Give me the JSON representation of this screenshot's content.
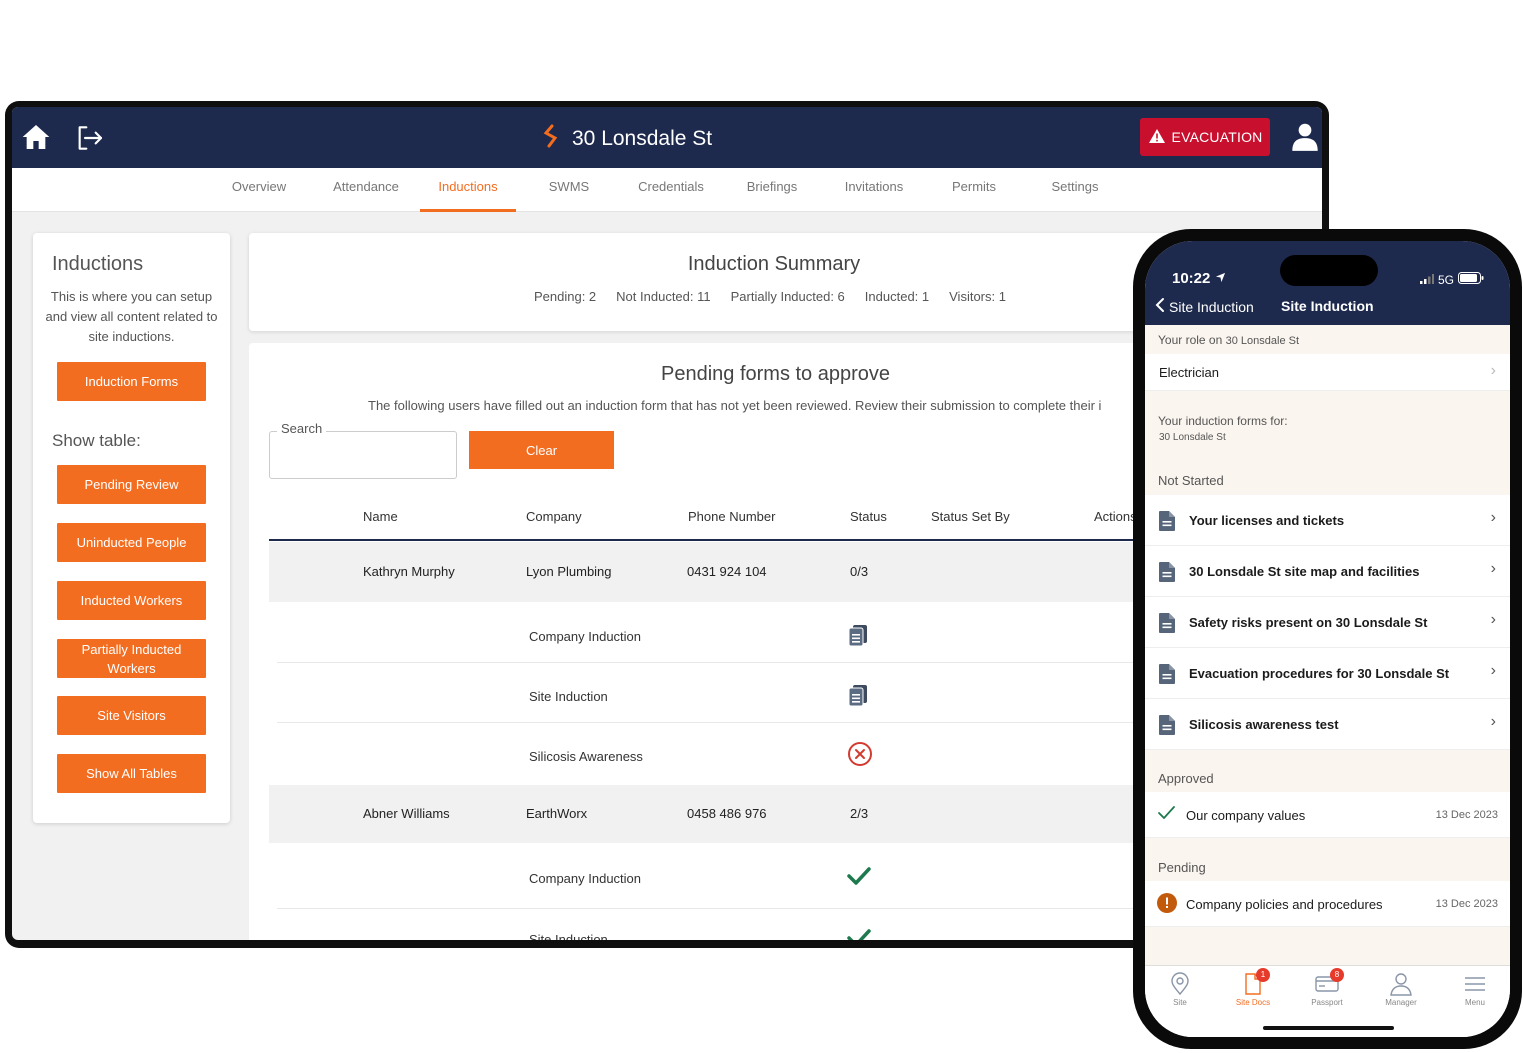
{
  "tablet": {
    "site_title": "30 Lonsdale St",
    "evacuation_label": "EVACUATION",
    "tabs": [
      {
        "label": "Overview",
        "active": false
      },
      {
        "label": "Attendance",
        "active": false
      },
      {
        "label": "Inductions",
        "active": true
      },
      {
        "label": "SWMS",
        "active": false
      },
      {
        "label": "Credentials",
        "active": false
      },
      {
        "label": "Briefings",
        "active": false
      },
      {
        "label": "Invitations",
        "active": false
      },
      {
        "label": "Permits",
        "active": false
      },
      {
        "label": "Settings",
        "active": false
      }
    ],
    "sidebar": {
      "title": "Inductions",
      "description": "This is where you can setup and view all content related to site inductions.",
      "forms_button": "Induction Forms",
      "show_table_label": "Show table:",
      "buttons": [
        "Pending Review",
        "Uninducted People",
        "Inducted Workers",
        "Partially Inducted Workers",
        "Site Visitors",
        "Show All Tables"
      ]
    },
    "summary": {
      "title": "Induction Summary",
      "stats": [
        "Pending: 2",
        "Not Inducted: 11",
        "Partially Inducted: 6",
        "Inducted: 1",
        "Visitors: 1"
      ]
    },
    "pending": {
      "title": "Pending forms to approve",
      "description": "The following users have filled out an induction form that has not yet been reviewed. Review their submission to complete their i",
      "search_label": "Search",
      "clear_label": "Clear",
      "columns": [
        "Name",
        "Company",
        "Phone Number",
        "Status",
        "Status Set By",
        "Actions"
      ],
      "rows": [
        {
          "name": "Kathryn Murphy",
          "company": "Lyon Plumbing",
          "phone": "0431 924 104",
          "status": "0/3",
          "forms": [
            {
              "label": "Company Induction",
              "status_icon": "clipboard-icon"
            },
            {
              "label": "Site Induction",
              "status_icon": "clipboard-icon"
            },
            {
              "label": "Silicosis Awareness",
              "status_icon": "cross-circle-icon"
            }
          ]
        },
        {
          "name": "Abner Williams",
          "company": "EarthWorx",
          "phone": "0458 486 976",
          "status": "2/3",
          "forms": [
            {
              "label": "Company Induction",
              "status_icon": "checkmark-icon"
            },
            {
              "label": "Site Induction",
              "status_icon": "checkmark-icon"
            }
          ]
        }
      ]
    }
  },
  "phone": {
    "time": "10:22",
    "network": "5G",
    "back_label": "Site Induction",
    "title": "Site Induction",
    "role_section_prefix": "Your role on",
    "role_section_site": "30 Lonsdale St",
    "role_value": "Electrician",
    "forms_section_title": "Your induction forms for:",
    "forms_section_site": "30 Lonsdale St",
    "not_started_label": "Not Started",
    "not_started_items": [
      "Your licenses and tickets",
      "30 Lonsdale St site map and facilities",
      "Safety risks present on 30 Lonsdale St",
      "Evacuation procedures for 30 Lonsdale St",
      "Silicosis awareness test"
    ],
    "approved_label": "Approved",
    "approved_items": [
      {
        "label": "Our company values",
        "date": "13 Dec 2023"
      }
    ],
    "pending_label": "Pending",
    "pending_items": [
      {
        "label": "Company policies and procedures",
        "date": "13 Dec 2023"
      }
    ],
    "nav": [
      {
        "label": "Site",
        "icon": "location-pin-icon",
        "badge": ""
      },
      {
        "label": "Site Docs",
        "icon": "documents-icon",
        "badge": "1"
      },
      {
        "label": "Passport",
        "icon": "passport-card-icon",
        "badge": "8"
      },
      {
        "label": "Manager",
        "icon": "person-icon",
        "badge": ""
      },
      {
        "label": "Menu",
        "icon": "hamburger-icon",
        "badge": ""
      }
    ]
  },
  "colors": {
    "navy": "#1e2a4d",
    "accent": "#f36d21",
    "evacuation": "#c8102e",
    "success": "#1e7a4e",
    "error": "#d23b30"
  }
}
